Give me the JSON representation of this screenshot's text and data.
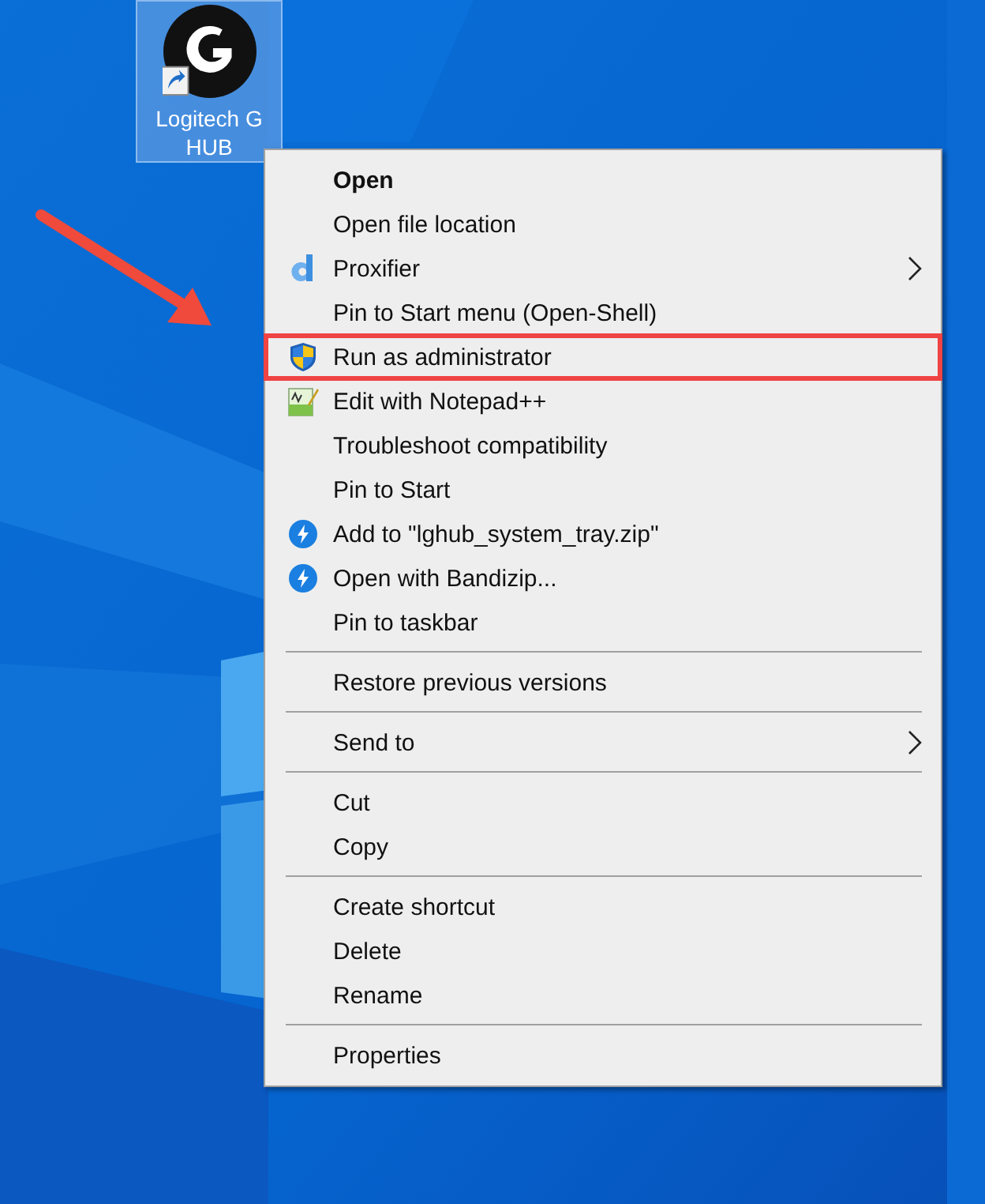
{
  "desktop_icon": {
    "label": "Logitech G HUB",
    "selected": true
  },
  "context_menu": {
    "items": [
      {
        "kind": "plain",
        "label": "Open",
        "default": true,
        "submenu": false,
        "highlighted": false
      },
      {
        "kind": "plain",
        "label": "Open file location",
        "default": false,
        "submenu": false,
        "highlighted": false
      },
      {
        "kind": "proxifier",
        "label": "Proxifier",
        "default": false,
        "submenu": true,
        "highlighted": false
      },
      {
        "kind": "plain",
        "label": "Pin to Start menu (Open-Shell)",
        "default": false,
        "submenu": false,
        "highlighted": false
      },
      {
        "kind": "shield",
        "label": "Run as administrator",
        "default": false,
        "submenu": false,
        "highlighted": true
      },
      {
        "kind": "notepad",
        "label": "Edit with Notepad++",
        "default": false,
        "submenu": false,
        "highlighted": false
      },
      {
        "kind": "plain",
        "label": "Troubleshoot compatibility",
        "default": false,
        "submenu": false,
        "highlighted": false
      },
      {
        "kind": "plain",
        "label": "Pin to Start",
        "default": false,
        "submenu": false,
        "highlighted": false
      },
      {
        "kind": "bandizip",
        "label": "Add to \"lghub_system_tray.zip\"",
        "default": false,
        "submenu": false,
        "highlighted": false
      },
      {
        "kind": "bandizip",
        "label": "Open with Bandizip...",
        "default": false,
        "submenu": false,
        "highlighted": false
      },
      {
        "kind": "plain",
        "label": "Pin to taskbar",
        "default": false,
        "submenu": false,
        "highlighted": false
      },
      {
        "kind": "separator"
      },
      {
        "kind": "plain",
        "label": "Restore previous versions",
        "default": false,
        "submenu": false,
        "highlighted": false
      },
      {
        "kind": "separator"
      },
      {
        "kind": "plain",
        "label": "Send to",
        "default": false,
        "submenu": true,
        "highlighted": false
      },
      {
        "kind": "separator"
      },
      {
        "kind": "plain",
        "label": "Cut",
        "default": false,
        "submenu": false,
        "highlighted": false
      },
      {
        "kind": "plain",
        "label": "Copy",
        "default": false,
        "submenu": false,
        "highlighted": false
      },
      {
        "kind": "separator"
      },
      {
        "kind": "plain",
        "label": "Create shortcut",
        "default": false,
        "submenu": false,
        "highlighted": false
      },
      {
        "kind": "plain",
        "label": "Delete",
        "default": false,
        "submenu": false,
        "highlighted": false
      },
      {
        "kind": "plain",
        "label": "Rename",
        "default": false,
        "submenu": false,
        "highlighted": false
      },
      {
        "kind": "separator"
      },
      {
        "kind": "plain",
        "label": "Properties",
        "default": false,
        "submenu": false,
        "highlighted": false
      }
    ]
  }
}
